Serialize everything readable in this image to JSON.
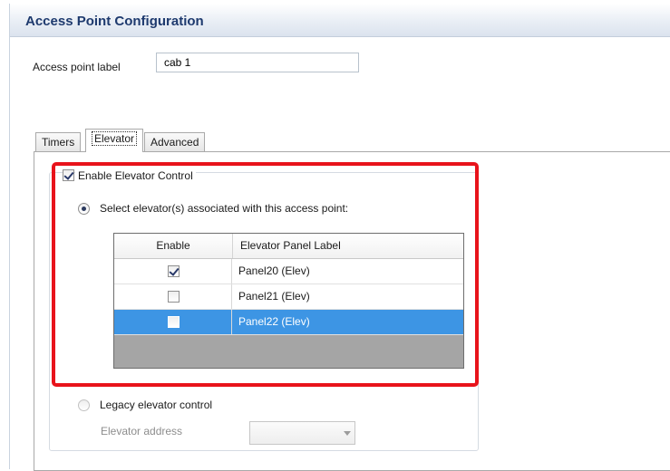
{
  "dialog": {
    "title": "Access Point Configuration"
  },
  "access_point": {
    "label_caption": "Access point label",
    "label_value": "cab 1"
  },
  "tabs": [
    {
      "label": "Timers",
      "active": false
    },
    {
      "label": "Elevator",
      "active": true
    },
    {
      "label": "Advanced",
      "active": false
    }
  ],
  "elevator": {
    "enable_control_label": "Enable Elevator Control",
    "enable_control_checked": true,
    "select_radio_label": "Select elevator(s) associated with this access point:",
    "select_radio_checked": true,
    "grid": {
      "columns": [
        "Enable",
        "Elevator Panel Label"
      ],
      "rows": [
        {
          "enabled": true,
          "label": "Panel20 (Elev)",
          "selected": false
        },
        {
          "enabled": false,
          "label": "Panel21 (Elev)",
          "selected": false
        },
        {
          "enabled": false,
          "label": "Panel22 (Elev)",
          "selected": true
        }
      ]
    },
    "legacy_radio_label": "Legacy elevator control",
    "legacy_radio_checked": false,
    "address_label": "Elevator address",
    "address_value": ""
  },
  "colors": {
    "title_text": "#1e3a6e",
    "highlight_border": "#e8131b",
    "selected_row": "#3d95e4"
  }
}
